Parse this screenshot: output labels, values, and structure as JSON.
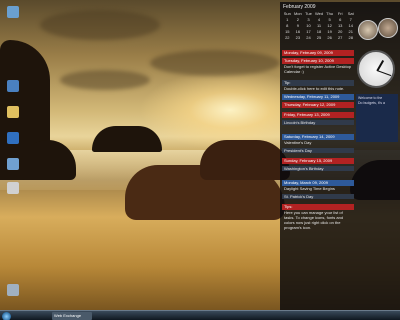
{
  "calendar": {
    "title": "February 2009",
    "weekdays": [
      "Sun",
      "Mon",
      "Tue",
      "Wed",
      "Thu",
      "Fri",
      "Sat"
    ],
    "weeks": [
      [
        "1",
        "2",
        "3",
        "4",
        "5",
        "6",
        "7"
      ],
      [
        "8",
        "9",
        "10",
        "11",
        "12",
        "13",
        "14"
      ],
      [
        "15",
        "16",
        "17",
        "18",
        "19",
        "20",
        "21"
      ],
      [
        "22",
        "23",
        "24",
        "25",
        "26",
        "27",
        "28"
      ]
    ]
  },
  "agenda": [
    {
      "date": "Monday, February 09, 2009",
      "text": "",
      "color": "#b22222"
    },
    {
      "date": "Tuesday, February 10, 2009",
      "text": "Don't forget to register Active Desktop Calendar :)",
      "color": "#b22222"
    },
    {
      "date": "Tip:",
      "text": "Double-click here to edit this note.",
      "color": "#303a4a"
    },
    {
      "date": "Wednesday, February 11, 2009",
      "text": "",
      "color": "#2e5a9a"
    },
    {
      "date": "Thursday, February 12, 2009",
      "text": "",
      "color": "#b22222"
    },
    {
      "date": "Friday, February 13, 2009",
      "text": "",
      "color": "#b22222"
    },
    {
      "date": "",
      "text": "Lincoln's Birthday",
      "color": "#303a4a"
    },
    {
      "date": "Saturday, February 14, 2009",
      "text": "Valentine's Day",
      "color": "#2e5a9a"
    },
    {
      "date": "",
      "text": "President's Day",
      "color": "#303a4a"
    },
    {
      "date": "Sunday, February 15, 2009",
      "text": "",
      "color": "#b22222"
    },
    {
      "date": "",
      "text": "Washington's Birthday",
      "color": "#303a4a"
    },
    {
      "date": "Monday, March 09, 2009",
      "text": "Daylight Saving Time Begins",
      "color": "#2e5a9a"
    },
    {
      "date": "",
      "text": "St. Patrick's Day",
      "color": "#303a4a"
    },
    {
      "date": "Tips:",
      "text": "Here you can manage your list of tasks. To change icons, fonts and colors now just right click on the program's icon.",
      "color": "#b22222"
    }
  ],
  "mini_gadget": [
    "Welcome to the",
    "Do budgets, it's a"
  ],
  "taskbar": {
    "task_label": "Web Exchange"
  },
  "icons": [
    {
      "name": "computer-icon",
      "color": "#6aa0d0"
    },
    {
      "name": "control-panel-icon",
      "color": "#4a80c0"
    },
    {
      "name": "folder-icon",
      "color": "#e0c060"
    },
    {
      "name": "outlook-icon",
      "color": "#3070c0"
    },
    {
      "name": "app-icon",
      "color": "#70a0d0"
    },
    {
      "name": "file-icon",
      "color": "#d0d0d0"
    },
    {
      "name": "recycle-bin-icon",
      "color": "#a0b0c0"
    }
  ]
}
